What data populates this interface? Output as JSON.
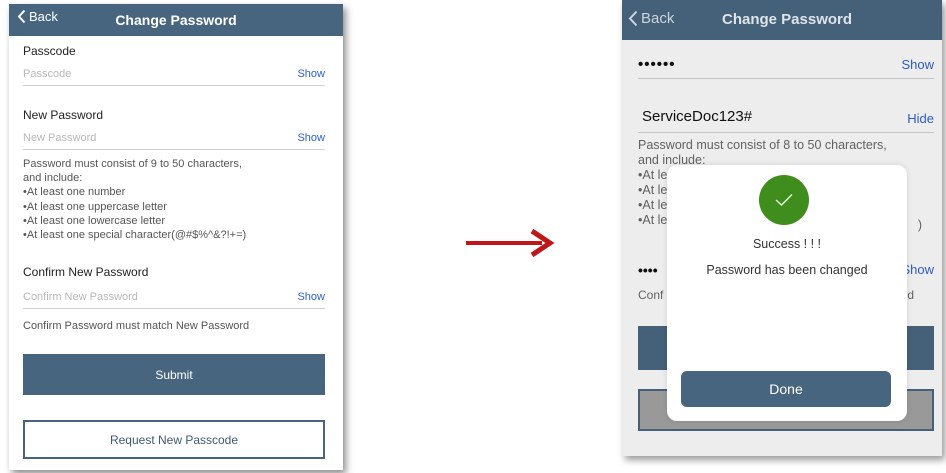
{
  "left": {
    "nav": {
      "back_label": "Back",
      "title": "Change Password"
    },
    "passcode": {
      "label": "Passcode",
      "placeholder": "Passcode",
      "toggle": "Show"
    },
    "new_password": {
      "label": "New Password",
      "placeholder": "New Password",
      "toggle": "Show"
    },
    "rules": [
      "Password must consist of 9 to 50 characters,",
      "and include:",
      "•At least one number",
      "•At least one uppercase letter",
      "•At least one lowercase letter",
      "•At least one special character(@#$%^&?!+=)"
    ],
    "confirm_password": {
      "label": "Confirm New Password",
      "placeholder": "Confirm New Password",
      "toggle": "Show"
    },
    "match_note": "Confirm Password must match New Password",
    "submit_label": "Submit",
    "request_label": "Request New Passcode"
  },
  "right": {
    "nav": {
      "back_label": "Back",
      "title": "Change Password"
    },
    "passcode_masked": "••••••",
    "passcode_toggle": "Show",
    "new_password_value": "ServiceDoc123#",
    "new_password_toggle": "Hide",
    "rules_visible": [
      "Password must consist of 8 to 50 characters,",
      "and include:",
      "•At le",
      "•At le",
      "•At le",
      "•At le"
    ],
    "rules_tail": ")",
    "confirm_masked": "••••",
    "confirm_toggle": "Show",
    "confirm_note_start": "Conf",
    "confirm_note_end": "rd",
    "dialog": {
      "title": "Success ! ! !",
      "message": "Password has been changed",
      "button_label": "Done",
      "icon": "checkmark-icon"
    }
  },
  "colors": {
    "nav_bg": "#47657e",
    "link": "#2f5fd0",
    "success": "#3f8d1c",
    "arrow": "#c0161a"
  }
}
